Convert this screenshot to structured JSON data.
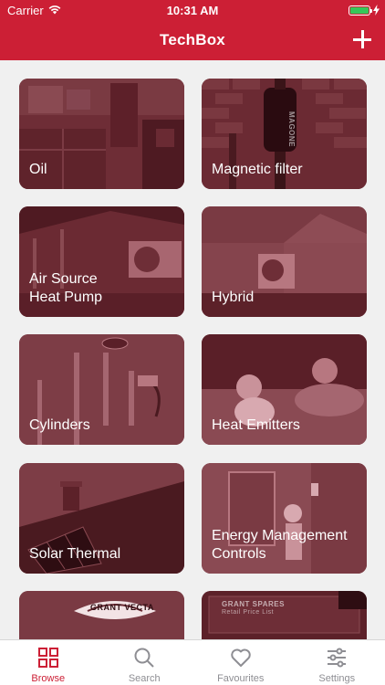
{
  "status_bar": {
    "carrier": "Carrier",
    "time": "10:31 AM"
  },
  "nav": {
    "title": "TechBox"
  },
  "tiles": [
    {
      "label": "Oil"
    },
    {
      "label": "Magnetic filter",
      "tag": "MAGONE"
    },
    {
      "label": "Air Source\nHeat Pump"
    },
    {
      "label": "Hybrid"
    },
    {
      "label": "Cylinders"
    },
    {
      "label": "Heat Emitters"
    },
    {
      "label": "Solar Thermal"
    },
    {
      "label": "Energy Management\nControls"
    },
    {
      "label": "",
      "tag": "GRANT VECTA"
    },
    {
      "label": "",
      "tag": "GRANT SPARES",
      "subtag": "Retail Price List"
    }
  ],
  "tabs": [
    {
      "label": "Browse",
      "icon": "grid-icon"
    },
    {
      "label": "Search",
      "icon": "search-icon"
    },
    {
      "label": "Favourites",
      "icon": "heart-icon"
    },
    {
      "label": "Settings",
      "icon": "sliders-icon"
    }
  ],
  "colors": {
    "brand": "#cc1f35",
    "tile": "#6b2a33",
    "tab_inactive": "#8e8e93"
  }
}
